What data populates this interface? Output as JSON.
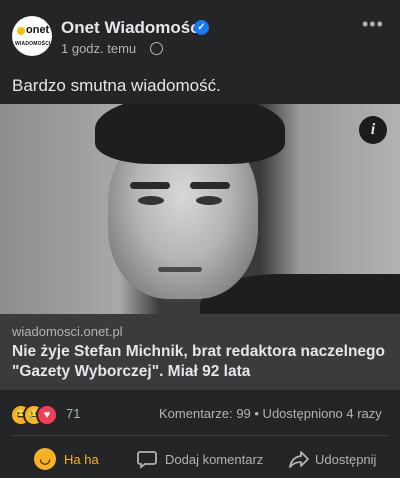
{
  "post": {
    "page_name": "Onet Wiadomości",
    "verified_icon": "verified-badge-icon",
    "time": "1 godz. temu",
    "privacy_icon": "globe-icon",
    "more_label": "•••",
    "avatar": {
      "brand": "onet",
      "subtitle": "WIADOMOŚCI"
    },
    "text": "Bardzo smutna wiadomość."
  },
  "link": {
    "domain": "wiadomosci.onet.pl",
    "headline": "Nie żyje Stefan Michnik, brat redaktora naczelnego \"Gazety Wyborczej\". Miał 92 lata",
    "info_icon": "i"
  },
  "stats": {
    "reactions": [
      "haha",
      "sad",
      "love"
    ],
    "reaction_count": "71",
    "comments_shares": "Komentarze: 99 • Udostępniono 4 razy"
  },
  "actions": {
    "reaction": "Ha ha",
    "comment": "Dodaj komentarz",
    "share": "Udostępnij"
  },
  "colors": {
    "background": "#242526",
    "link_box": "#3a3b3c",
    "text_primary": "#e4e6eb",
    "text_secondary": "#b0b3b8",
    "verified": "#1877f2",
    "haha_active": "#f7b125"
  }
}
